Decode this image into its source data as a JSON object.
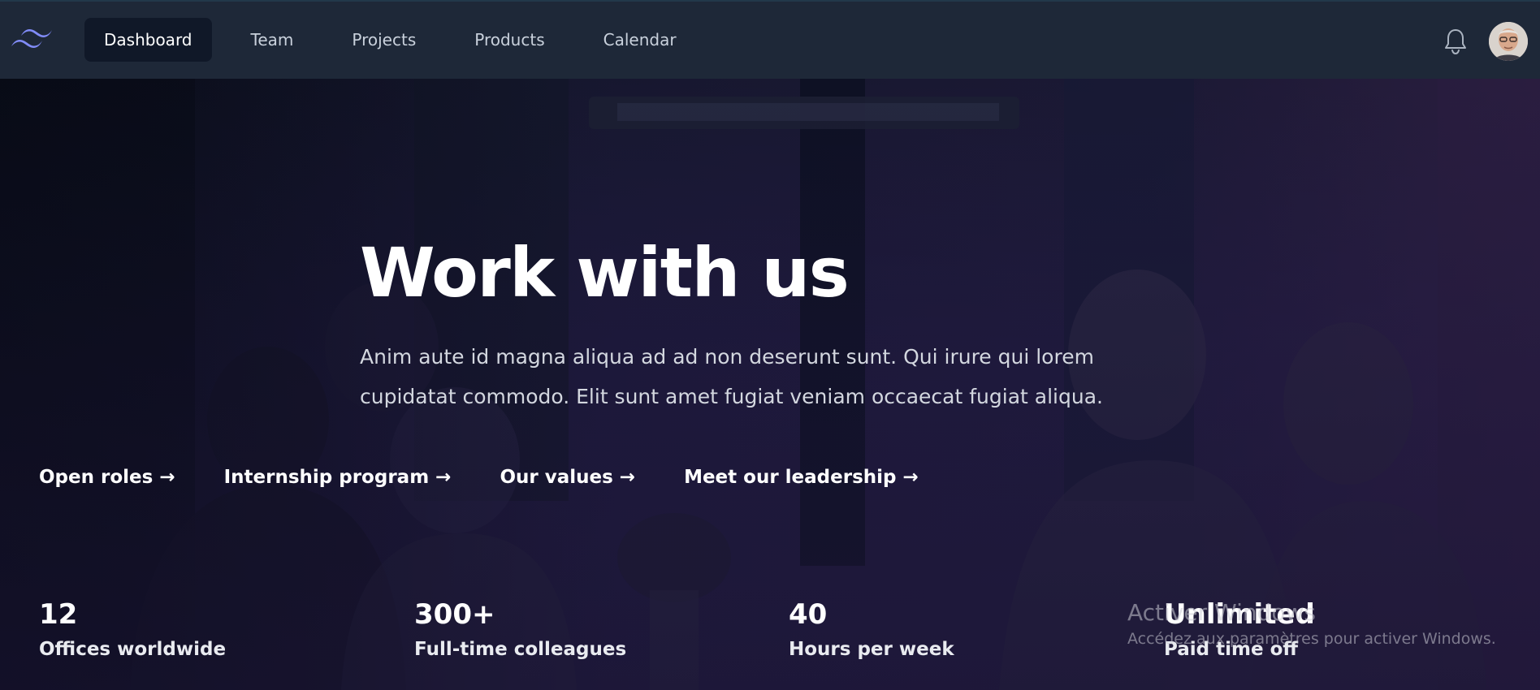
{
  "nav": {
    "logo_icon": "tailwind-logo-icon",
    "links": [
      {
        "label": "Dashboard",
        "active": true
      },
      {
        "label": "Team",
        "active": false
      },
      {
        "label": "Projects",
        "active": false
      },
      {
        "label": "Products",
        "active": false
      },
      {
        "label": "Calendar",
        "active": false
      }
    ],
    "bell_icon": "bell-icon",
    "avatar_icon": "user-avatar"
  },
  "hero": {
    "title": "Work with us",
    "description": "Anim aute id magna aliqua ad ad non deserunt sunt. Qui irure qui lorem cupidatat commodo. Elit sunt amet fugiat veniam occaecat fugiat aliqua.",
    "links": [
      {
        "label": "Open roles →"
      },
      {
        "label": "Internship program →"
      },
      {
        "label": "Our values →"
      },
      {
        "label": "Meet our leadership →"
      }
    ],
    "stats": [
      {
        "value": "12",
        "label": "Offices worldwide"
      },
      {
        "value": "300+",
        "label": "Full-time colleagues"
      },
      {
        "value": "40",
        "label": "Hours per week"
      },
      {
        "value": "Unlimited",
        "label": "Paid time off"
      }
    ]
  },
  "watermark": {
    "title": "Activer Windows",
    "subtitle": "Accédez aux paramètres pour activer Windows."
  },
  "colors": {
    "nav_bg": "#1e2838",
    "nav_active_bg": "#101828",
    "logo_accent": "#818cf8",
    "hero_overlay": "#1d1a3c"
  }
}
